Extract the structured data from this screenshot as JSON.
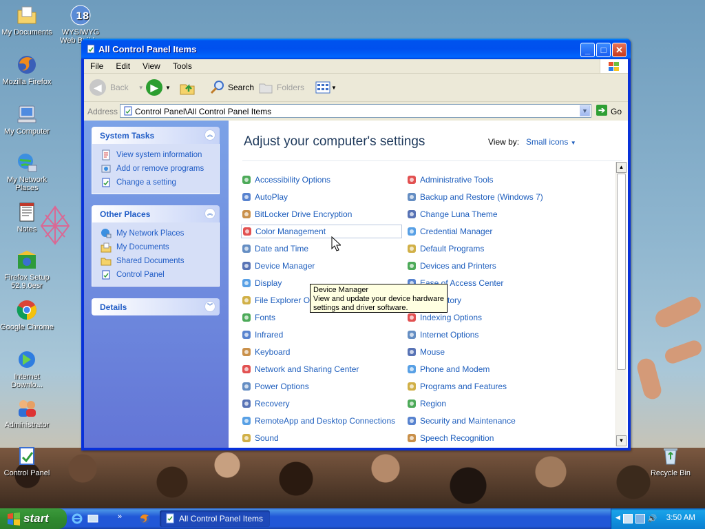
{
  "desktop": {
    "icons": [
      {
        "label": "My Documents",
        "icon": "my-documents-icon"
      },
      {
        "label": "WYSIWYG Web Builder",
        "icon": "wysiwyg-web-builder-icon"
      },
      {
        "label": "Mozilla Firefox",
        "icon": "firefox-icon"
      },
      {
        "label": "My Computer",
        "icon": "my-computer-icon"
      },
      {
        "label": "My Network Places",
        "icon": "network-places-icon"
      },
      {
        "label": "Notes",
        "icon": "notes-icon"
      },
      {
        "label": "Firefox Setup 52.9.0esr",
        "icon": "firefox-setup-icon"
      },
      {
        "label": "Google Chrome",
        "icon": "chrome-icon"
      },
      {
        "label": "Internet Downlo...",
        "icon": "internet-download-icon"
      },
      {
        "label": "Administrator",
        "icon": "administrator-icon"
      },
      {
        "label": "Control Panel",
        "icon": "control-panel-icon"
      },
      {
        "label": "Recycle Bin",
        "icon": "recycle-bin-icon"
      }
    ]
  },
  "window": {
    "title": "All Control Panel Items",
    "menu": [
      "File",
      "Edit",
      "View",
      "Tools"
    ],
    "toolbar": {
      "back": "Back",
      "search": "Search",
      "folders": "Folders"
    },
    "address": {
      "label": "Address",
      "value": "Control Panel\\All Control Panel Items",
      "go": "Go"
    }
  },
  "taskpane": {
    "system_tasks": {
      "title": "System Tasks",
      "items": [
        "View system information",
        "Add or remove programs",
        "Change a setting"
      ]
    },
    "other_places": {
      "title": "Other Places",
      "items": [
        "My Network Places",
        "My Documents",
        "Shared Documents",
        "Control Panel"
      ]
    },
    "details": {
      "title": "Details"
    }
  },
  "content": {
    "heading": "Adjust your computer's settings",
    "view_by_label": "View by:",
    "view_by_value": "Small icons",
    "left_items": [
      "Accessibility Options",
      "AutoPlay",
      "BitLocker Drive Encryption",
      "Color Management",
      "Date and Time",
      "Device Manager",
      "Display",
      "File Explorer Op",
      "Fonts",
      "Infrared",
      "Keyboard",
      "Network and Sharing Center",
      "Power Options",
      "Recovery",
      "RemoteApp and Desktop Connections",
      "Sound"
    ],
    "right_items": [
      "Administrative Tools",
      "Backup and Restore (Windows 7)",
      "Change Luna Theme",
      "Credential Manager",
      "Default Programs",
      "Devices and Printers",
      "Ease of Access Center",
      "File History",
      "Indexing Options",
      "Internet Options",
      "Mouse",
      "Phone and Modem",
      "Programs and Features",
      "Region",
      "Security and Maintenance",
      "Speech Recognition"
    ],
    "hovered_item": "Color Management",
    "tooltip": {
      "title": "Device Manager",
      "line1": "View and update your device hardware",
      "line2": "settings and driver software."
    }
  },
  "taskbar": {
    "start_label": "start",
    "task": "All Control Panel Items",
    "clock": "3:50 AM"
  },
  "colors": {
    "link": "#1e5ebd",
    "taskpane_link": "#215dc6",
    "title_bar": "#0053ee",
    "start_green": "#2f8a2f"
  }
}
